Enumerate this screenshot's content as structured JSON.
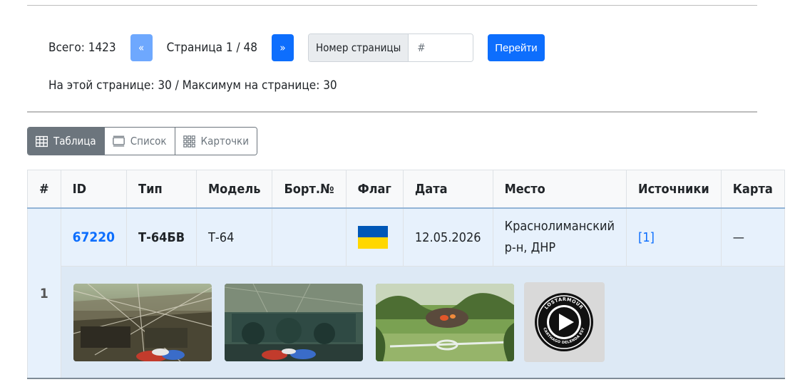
{
  "pager": {
    "total": "Всего: 1423",
    "prev": "«",
    "page_info": "Страница 1 / 48",
    "next": "»",
    "page_number_label": "Номер страницы",
    "page_input_placeholder": "#",
    "go_label": "Перейти",
    "per_page": "На этой странице: 30 / Максимум на странице: 30"
  },
  "views": [
    {
      "label": "Таблица",
      "icon": "table-icon",
      "active": true
    },
    {
      "label": "Список",
      "icon": "list-icon",
      "active": false
    },
    {
      "label": "Карточки",
      "icon": "cards-icon",
      "active": false
    }
  ],
  "table": {
    "columns": [
      "#",
      "ID",
      "Тип",
      "Модель",
      "Борт.№",
      "Флаг",
      "Дата",
      "Место",
      "Источники",
      "Карта"
    ],
    "rows": [
      {
        "num": "1",
        "id": "67220",
        "type": "Т-64БВ",
        "model": "Т-64",
        "board": "",
        "flag": "ukraine-flag",
        "date": "12.05.2026",
        "place_line1": "Краснолиманский",
        "place_line2": "р-н, ДНР",
        "sources": "[1]",
        "map": "—",
        "media": [
          {
            "kind": "image",
            "name": "destroyed-vehicle-camouflage-photo"
          },
          {
            "kind": "image",
            "name": "vehicle-interior-photo"
          },
          {
            "kind": "image",
            "name": "burning-vehicle-field-photo"
          },
          {
            "kind": "video",
            "name": "lostarmour-video-play-icon"
          }
        ]
      }
    ]
  },
  "colors": {
    "primary": "#0d6efd",
    "primary_light": "#6ea8fe",
    "secondary": "#6c757d",
    "row_highlight": "#e7f1fc",
    "flag_blue": "#0057b7",
    "flag_yellow": "#ffd700"
  },
  "logo_text": "LOSTARMOUR · CARTHAGO DELENDA EST"
}
